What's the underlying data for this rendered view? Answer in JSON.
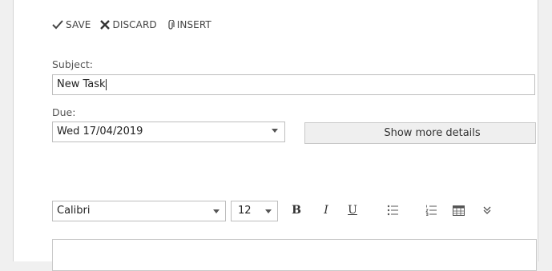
{
  "toolbar": {
    "save_label": "SAVE",
    "discard_label": "DISCARD",
    "insert_label": "INSERT"
  },
  "form": {
    "subject_label": "Subject:",
    "subject_value": "New Task",
    "due_label": "Due:",
    "due_value": "Wed 17/04/2019",
    "more_details_label": "Show more details"
  },
  "format_bar": {
    "font_name": "Calibri",
    "font_size": "12",
    "bold_glyph": "B",
    "italic_glyph": "I",
    "underline_glyph": "U"
  },
  "colors": {
    "accent": "#2b579a",
    "border": "#bdbdbd"
  }
}
